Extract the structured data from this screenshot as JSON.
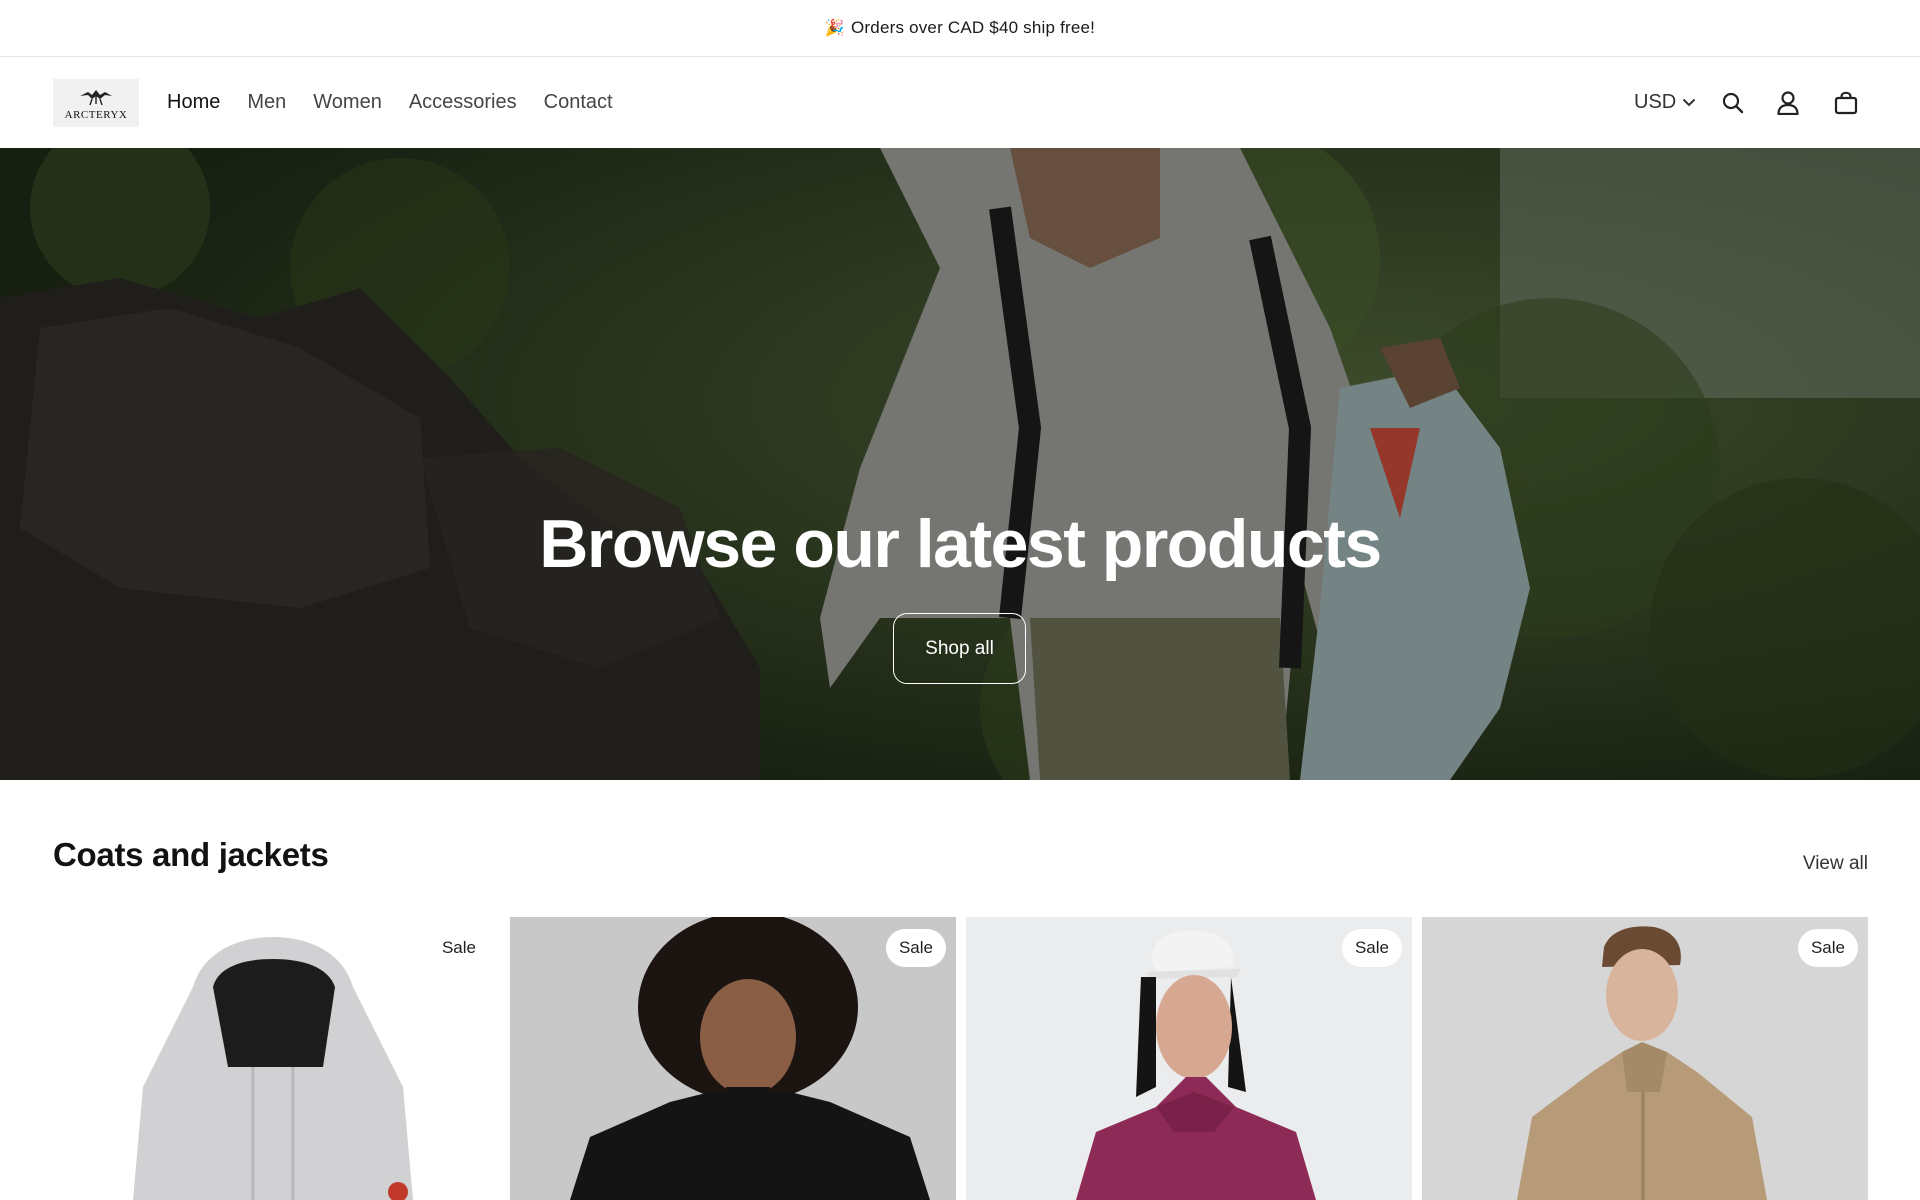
{
  "announcement": {
    "emoji": "🎉",
    "text": "Orders over CAD $40 ship free!"
  },
  "brand": {
    "logo_text": "ARCTERYX"
  },
  "nav": {
    "items": [
      {
        "label": "Home",
        "active": true
      },
      {
        "label": "Men"
      },
      {
        "label": "Women"
      },
      {
        "label": "Accessories"
      },
      {
        "label": "Contact"
      }
    ]
  },
  "header": {
    "currency": "USD",
    "icons": [
      "search-icon",
      "account-icon",
      "cart-icon"
    ]
  },
  "hero": {
    "title": "Browse our latest products",
    "button_label": "Shop all"
  },
  "collection": {
    "title": "Coats and jackets",
    "view_all_label": "View all",
    "products": [
      {
        "badge": "Sale"
      },
      {
        "badge": "Sale"
      },
      {
        "badge": "Sale"
      },
      {
        "badge": "Sale"
      }
    ]
  },
  "colors": {
    "text": "#121212",
    "hero_overlay": "#2f3a25",
    "badge_bg": "#ffffff"
  }
}
